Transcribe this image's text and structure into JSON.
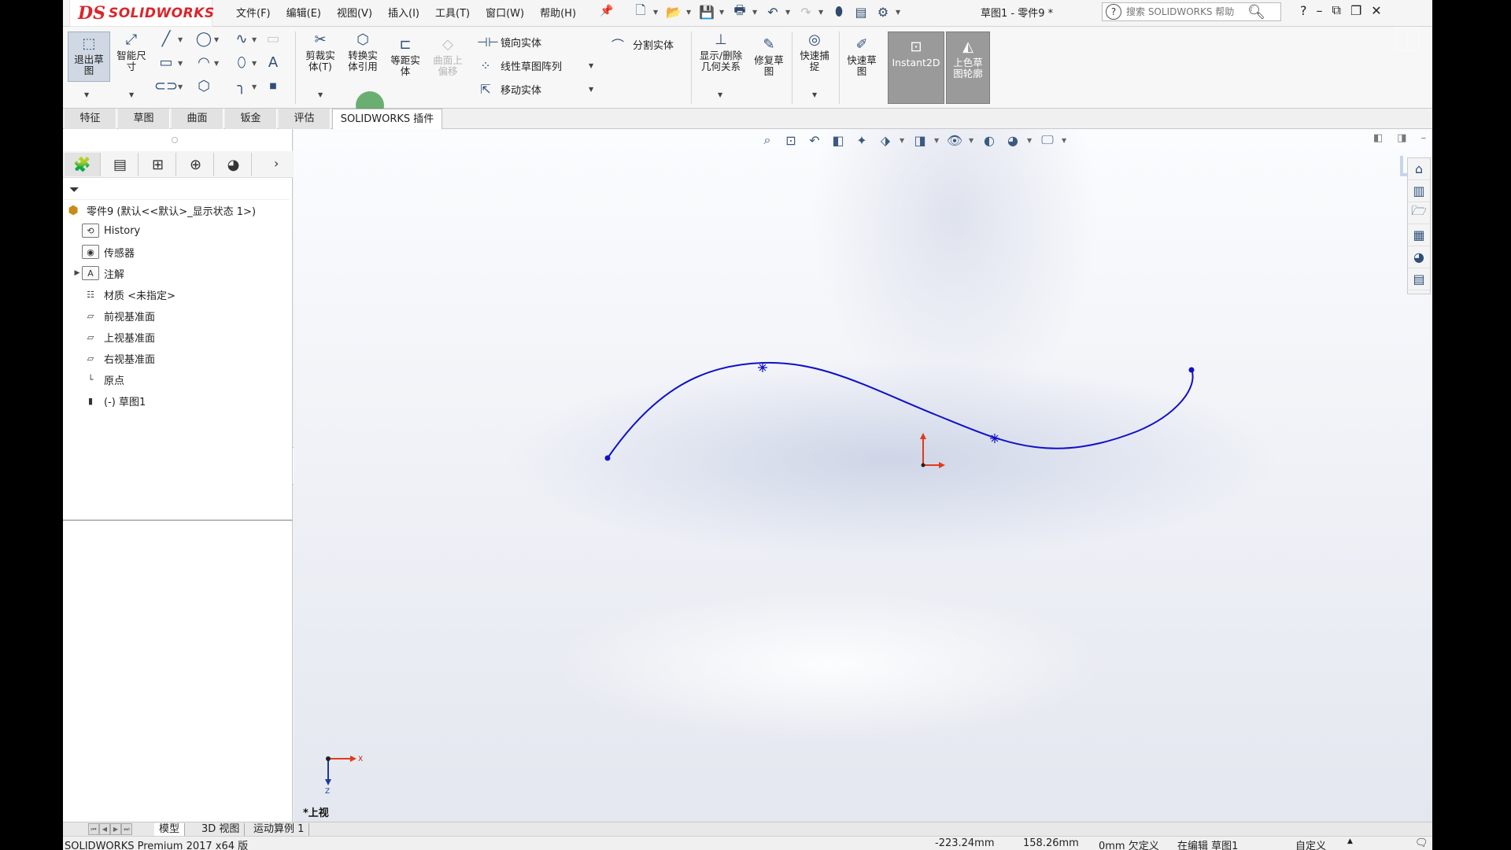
{
  "app": {
    "brand": "SOLIDWORKS",
    "brand_mark": "DS",
    "menu": [
      "文件(F)",
      "编辑(E)",
      "视图(V)",
      "插入(I)",
      "工具(T)",
      "窗口(W)",
      "帮助(H)"
    ],
    "document_title": "草图1 - 零件9 *",
    "search_placeholder": "搜索 SOLIDWORKS 帮助",
    "help_label": "?"
  },
  "ribbon": {
    "exit_sketch": "退出草图",
    "smart_dimension": "智能尺寸",
    "trim_entities": "剪裁实体(T)",
    "convert_entities": "转换实体引用",
    "offset_entities": "等距实体",
    "offset_on_surface": "曲面上偏移",
    "mirror_entities": "镜向实体",
    "linear_pattern": "线性草图阵列",
    "move_entities": "移动实体",
    "split_entities": "分割实体",
    "display_relations": "显示/删除几何关系",
    "repair_sketch": "修复草图",
    "quick_snaps": "快速捕捉",
    "rapid_sketch": "快速草图",
    "instant2d": "Instant2D",
    "shaded_contours": "上色草图轮廓"
  },
  "command_tabs": [
    {
      "label": "特征",
      "active": false
    },
    {
      "label": "草图",
      "active": false
    },
    {
      "label": "曲面",
      "active": false
    },
    {
      "label": "钣金",
      "active": false
    },
    {
      "label": "评估",
      "active": false
    },
    {
      "label": "SOLIDWORKS 插件",
      "active": true
    }
  ],
  "feature_tree": {
    "root": "零件9 (默认<<默认>_显示状态 1>)",
    "items": [
      "History",
      "传感器",
      "注解",
      "材质 <未指定>",
      "前视基准面",
      "上视基准面",
      "右视基准面",
      "原点",
      "(-) 草图1"
    ]
  },
  "viewport": {
    "view_name": "*上视",
    "triad_x": "X",
    "triad_z": "Z"
  },
  "bottom_tabs": [
    "模型",
    "3D 视图",
    "运动算例 1"
  ],
  "status": {
    "product": "SOLIDWORKS Premium 2017 x64 版",
    "x": "-223.24mm",
    "y": "158.26mm",
    "z_state": "0mm 欠定义",
    "editing": "在编辑 草图1",
    "units": "自定义"
  },
  "colors": {
    "spline": "#1010c8",
    "brand": "#d9262c",
    "axis_red": "#e03a1a",
    "axis_blue": "#1a3aa0"
  }
}
